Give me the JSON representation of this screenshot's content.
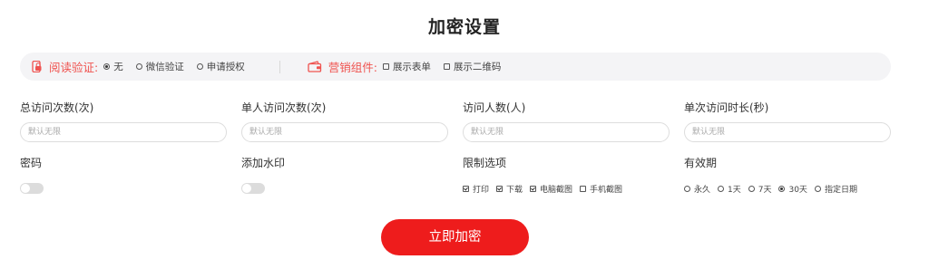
{
  "title": "加密设置",
  "colors": {
    "accent": "#ee1c1c",
    "label_red": "#ef5350",
    "bar_bg": "#f4f4f6"
  },
  "auth_bar": {
    "read_verify": {
      "icon": "phone-lock-icon",
      "title": "阅读验证:",
      "options": [
        {
          "label": "无",
          "selected": true
        },
        {
          "label": "微信验证",
          "selected": false
        },
        {
          "label": "申请授权",
          "selected": false
        }
      ]
    },
    "marketing": {
      "icon": "wallet-icon",
      "title": "营销组件:",
      "options": [
        {
          "label": "展示表单",
          "checked": false
        },
        {
          "label": "展示二维码",
          "checked": false
        }
      ]
    }
  },
  "fields": {
    "total_visits": {
      "label": "总访问次数(次)",
      "placeholder": "默认无限"
    },
    "single_visits": {
      "label": "单人访问次数(次)",
      "placeholder": "默认无限"
    },
    "visitors": {
      "label": "访问人数(人)",
      "placeholder": "默认无限"
    },
    "duration": {
      "label": "单次访问时长(秒)",
      "placeholder": "默认无限"
    }
  },
  "password": {
    "label": "密码",
    "enabled": false
  },
  "watermark": {
    "label": "添加水印",
    "enabled": false
  },
  "limits": {
    "label": "限制选项",
    "options": [
      {
        "label": "打印",
        "checked": true
      },
      {
        "label": "下载",
        "checked": true
      },
      {
        "label": "电脑截图",
        "checked": true
      },
      {
        "label": "手机截图",
        "checked": false
      }
    ]
  },
  "validity": {
    "label": "有效期",
    "options": [
      {
        "label": "永久",
        "selected": false
      },
      {
        "label": "1天",
        "selected": false
      },
      {
        "label": "7天",
        "selected": false
      },
      {
        "label": "30天",
        "selected": true
      },
      {
        "label": "指定日期",
        "selected": false
      }
    ]
  },
  "submit_label": "立即加密"
}
